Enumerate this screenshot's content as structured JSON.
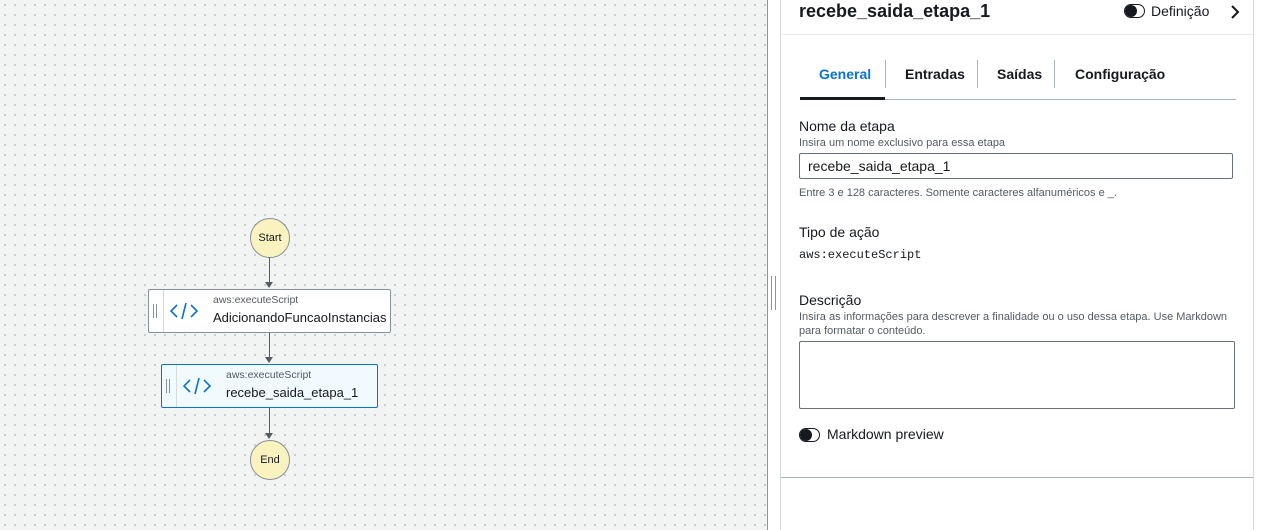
{
  "panel": {
    "title": "recebe_saida_etapa_1",
    "definition_toggle_label": "Definição"
  },
  "tabs": [
    "General",
    "Entradas",
    "Saídas",
    "Configuração"
  ],
  "form": {
    "step_name_label": "Nome da etapa",
    "step_name_description": "Insira um nome exclusivo para essa etapa",
    "step_name_value": "recebe_saida_etapa_1",
    "step_name_constraint": "Entre 3 e 128 caracteres. Somente caracteres alfanuméricos e _.",
    "action_type_label": "Tipo de ação",
    "action_type_value": "aws:executeScript",
    "description_label": "Descrição",
    "description_help": "Insira as informações para descrever a finalidade ou o uso dessa etapa. Use Markdown para formatar o conteúdo.",
    "description_value": "",
    "markdown_preview_label": "Markdown preview"
  },
  "flow": {
    "start_label": "Start",
    "end_label": "End",
    "steps": [
      {
        "type": "aws:executeScript",
        "name": "AdicionandoFuncaoInstancias",
        "selected": false
      },
      {
        "type": "aws:executeScript",
        "name": "recebe_saida_etapa_1",
        "selected": true
      }
    ]
  },
  "colors": {
    "accent": "#0972d3",
    "terminal_node_fill": "#faf3c0",
    "selected_step_fill": "#f1faff"
  }
}
